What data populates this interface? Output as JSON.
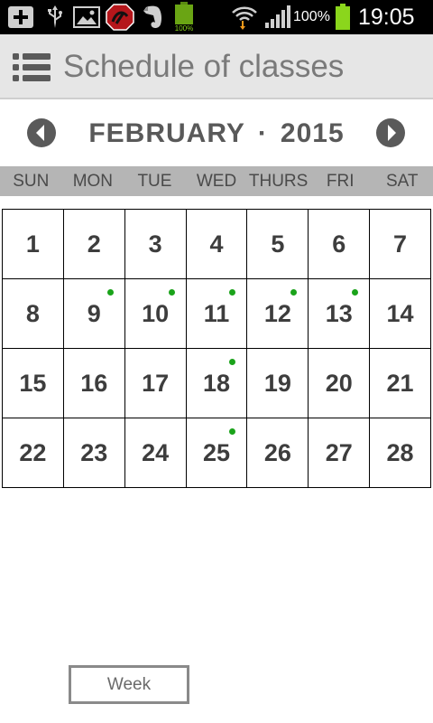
{
  "status_bar": {
    "battery_percent_label": "100%",
    "battery_icon_label": "100%",
    "time": "19:05",
    "icons": [
      "add-icon",
      "usb-icon",
      "image-icon",
      "app-red-icon",
      "evernote-icon",
      "battery-app-icon",
      "wifi-icon",
      "signal-icon",
      "battery-icon"
    ]
  },
  "app_bar": {
    "title": "Schedule of classes",
    "menu_icon": "menu-list-icon"
  },
  "month_nav": {
    "month": "FEBRUARY",
    "separator": "·",
    "year": "2015",
    "prev_icon": "chevron-left-circle-icon",
    "next_icon": "chevron-right-circle-icon"
  },
  "weekdays": [
    "SUN",
    "MON",
    "TUE",
    "WED",
    "THURS",
    "FRI",
    "SAT"
  ],
  "days": [
    {
      "num": "1",
      "dot": false
    },
    {
      "num": "2",
      "dot": false
    },
    {
      "num": "3",
      "dot": false
    },
    {
      "num": "4",
      "dot": false
    },
    {
      "num": "5",
      "dot": false
    },
    {
      "num": "6",
      "dot": false
    },
    {
      "num": "7",
      "dot": false
    },
    {
      "num": "8",
      "dot": false
    },
    {
      "num": "9",
      "dot": true
    },
    {
      "num": "10",
      "dot": true
    },
    {
      "num": "11",
      "dot": true
    },
    {
      "num": "12",
      "dot": true
    },
    {
      "num": "13",
      "dot": true
    },
    {
      "num": "14",
      "dot": false
    },
    {
      "num": "15",
      "dot": false
    },
    {
      "num": "16",
      "dot": false
    },
    {
      "num": "17",
      "dot": false
    },
    {
      "num": "18",
      "dot": true
    },
    {
      "num": "19",
      "dot": false
    },
    {
      "num": "20",
      "dot": false
    },
    {
      "num": "21",
      "dot": false
    },
    {
      "num": "22",
      "dot": false
    },
    {
      "num": "23",
      "dot": false
    },
    {
      "num": "24",
      "dot": false
    },
    {
      "num": "25",
      "dot": true
    },
    {
      "num": "26",
      "dot": false
    },
    {
      "num": "27",
      "dot": false
    },
    {
      "num": "28",
      "dot": false
    }
  ],
  "footer": {
    "week_button": "Week"
  },
  "colors": {
    "status_bar_bg": "#000000",
    "app_bar_bg": "#e6e6e6",
    "title_text": "#7a7a7a",
    "weekday_bar_bg": "#b5b5b5",
    "event_dot": "#1aa31a",
    "battery_green": "#8bd61c"
  }
}
